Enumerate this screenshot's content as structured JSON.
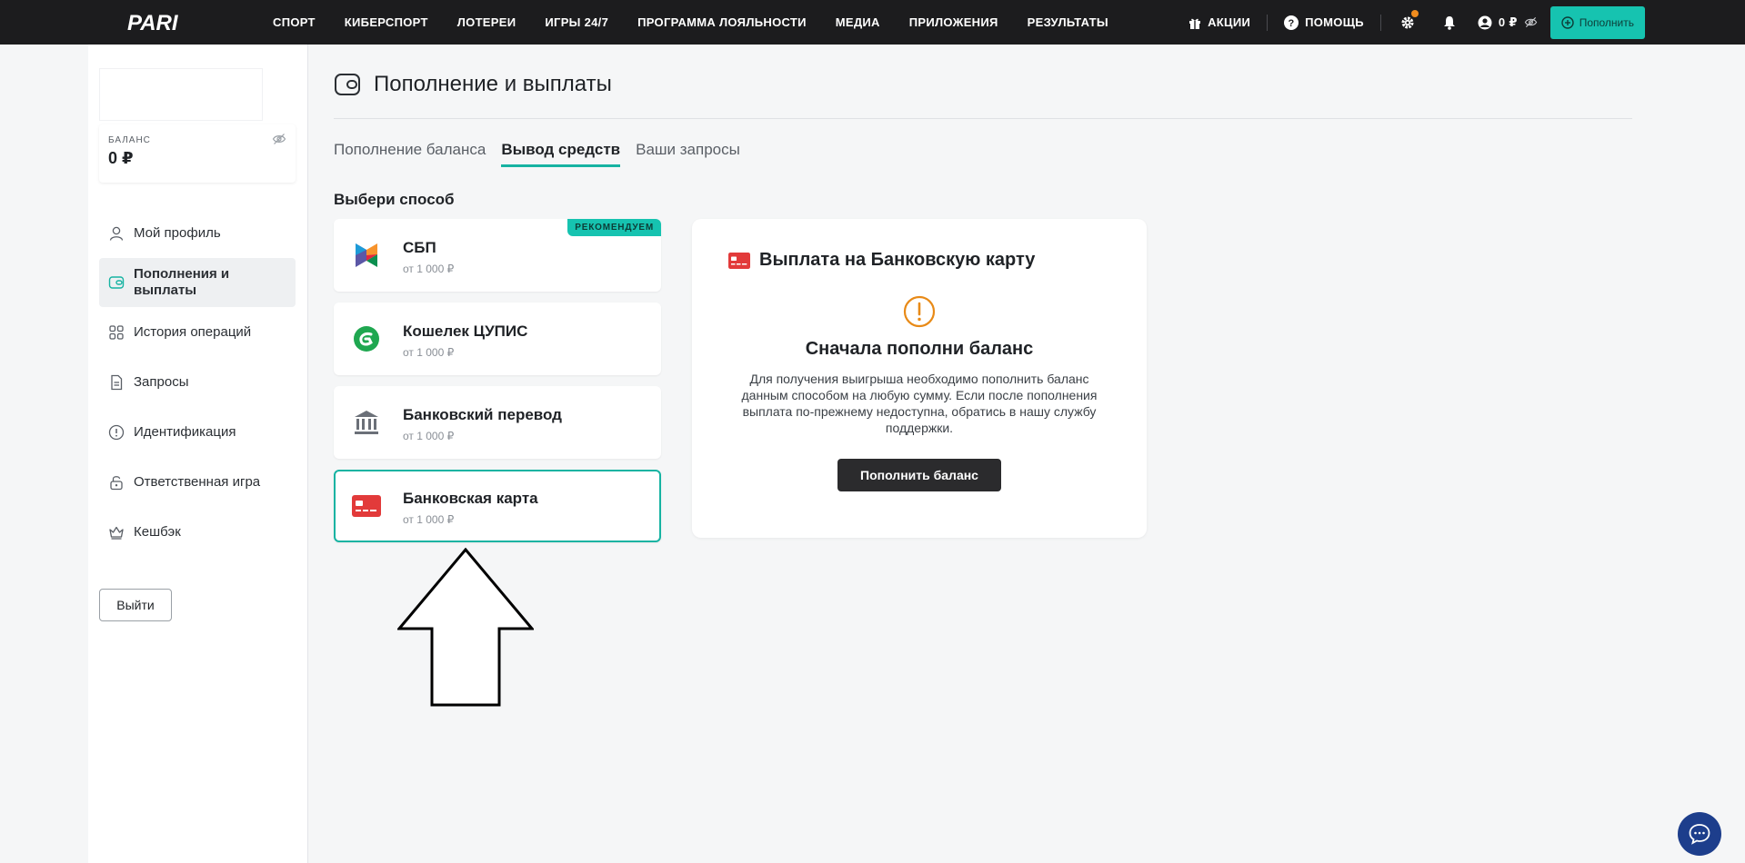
{
  "header": {
    "logo_text": "PARI",
    "nav": [
      "СПОРТ",
      "КИБЕРСПОРТ",
      "ЛОТЕРЕИ",
      "ИГРЫ 24/7",
      "ПРОГРАММА ЛОЯЛЬНОСТИ",
      "МЕДИА",
      "ПРИЛОЖЕНИЯ",
      "РЕЗУЛЬТАТЫ"
    ],
    "promo_label": "АКЦИИ",
    "help_label": "ПОМОЩЬ",
    "balance_label": "0 ₽",
    "deposit_label": "Пополнить"
  },
  "sidebar": {
    "balance_caption": "БАЛАНС",
    "balance_value": "0 ₽",
    "items": [
      {
        "label": "Мой профиль",
        "icon": "user-icon"
      },
      {
        "label": "Пополнения и выплаты",
        "icon": "wallet-icon"
      },
      {
        "label": "История операций",
        "icon": "grid-icon"
      },
      {
        "label": "Запросы",
        "icon": "document-icon"
      },
      {
        "label": "Идентификация",
        "icon": "info-circle-icon"
      },
      {
        "label": "Ответственная игра",
        "icon": "lock-icon"
      },
      {
        "label": "Кешбэк",
        "icon": "crown-icon"
      }
    ],
    "logout_label": "Выйти"
  },
  "main": {
    "title": "Пополнение и выплаты",
    "tabs": [
      "Пополнение баланса",
      "Вывод средств",
      "Ваши запросы"
    ],
    "section_label": "Выбери способ",
    "methods": [
      {
        "title": "СБП",
        "sub": "от 1 000 ₽",
        "badge": "РЕКОМЕНДУЕМ"
      },
      {
        "title": "Кошелек ЦУПИС",
        "sub": "от 1 000 ₽"
      },
      {
        "title": "Банковский перевод",
        "sub": "от 1 000 ₽"
      },
      {
        "title": "Банковская карта",
        "sub": "от 1 000 ₽"
      }
    ],
    "payout": {
      "title": "Выплата на Банковскую карту",
      "heading": "Сначала пополни баланс",
      "text": "Для получения выигрыша необходимо пополнить баланс данным способом на любую сумму. Если после пополнения выплата по-прежнему недоступна, обратись в нашу службу поддержки.",
      "button": "Пополнить баланс"
    }
  },
  "colors": {
    "accent": "#16c3b0",
    "topbar": "#1c1c1e",
    "warning": "#e88a17",
    "card_red": "#e23a3a",
    "chat": "#1d3e8c"
  }
}
